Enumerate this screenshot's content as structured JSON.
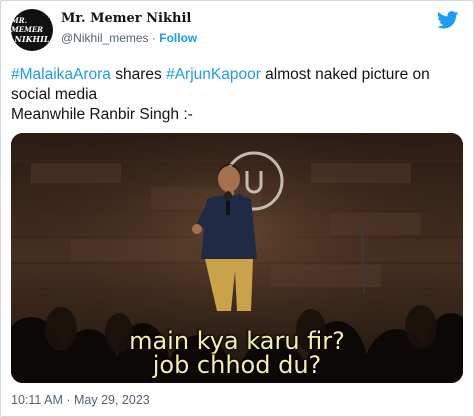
{
  "author": {
    "display_name": "Mr. Memer Nikhil",
    "handle": "@Nikhil_memes",
    "separator": "·",
    "follow_label": "Follow",
    "avatar_line1": "MR. MEMER",
    "avatar_line2": "NIKHIL"
  },
  "tweet": {
    "hashtag1": "#MalaikaArora",
    "text1": " shares ",
    "hashtag2": "#ArjunKapoor",
    "text2": " almost naked picture on social media",
    "line2": "Meanwhile Ranbir Singh :-"
  },
  "media": {
    "subtitle_line1": "main kya karu fir?",
    "subtitle_line2": "job chhod du?"
  },
  "footer": {
    "timestamp": "10:11 AM · May 29, 2023"
  },
  "icons": {
    "platform": "twitter-bird-icon"
  },
  "colors": {
    "accent": "#1d9bf0",
    "text": "#0f1419",
    "muted": "#536471"
  }
}
